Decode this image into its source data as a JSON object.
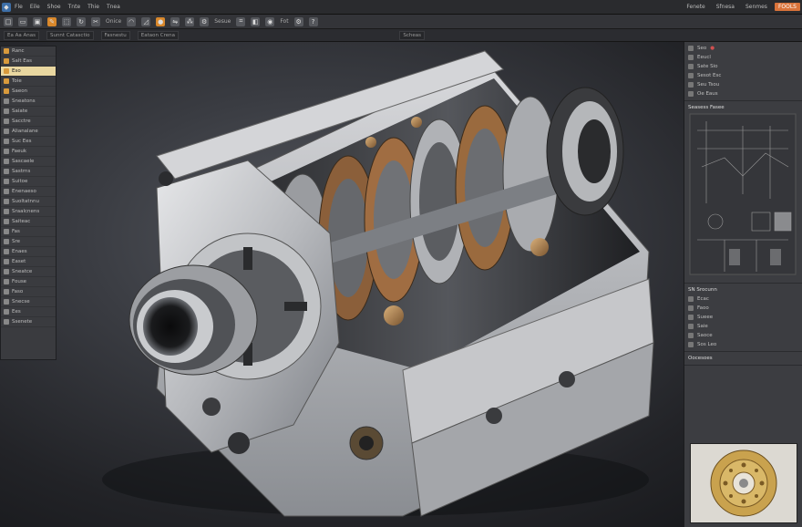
{
  "menubar": {
    "items": [
      "Fle",
      "Eile",
      "Shoe",
      "Tnte",
      "Thie",
      "Tnea"
    ],
    "right_items": [
      "Fenete",
      "Sfnesa",
      "Senmes"
    ],
    "action_label": "FOOLS"
  },
  "toolbar1": {
    "labels": [
      "Onice",
      "Sesue",
      "Fot"
    ]
  },
  "toolbar2": {
    "tabs": [
      "Ea Aa Anas",
      "Sunnt Catasctio",
      "Fasnestu",
      "Eataon Crena",
      "Scheas"
    ]
  },
  "left_panel": {
    "rows": [
      {
        "label": "Ranc",
        "icon": "folder-icon",
        "selected": false
      },
      {
        "label": "Salt Eas",
        "icon": "folder-icon",
        "selected": false
      },
      {
        "label": "Eso",
        "icon": "folder-icon",
        "selected": true
      },
      {
        "label": "Toie",
        "icon": "folder-icon",
        "selected": false
      },
      {
        "label": "Saeon",
        "icon": "folder-icon",
        "selected": false
      },
      {
        "label": "Sneatons",
        "icon": "part-icon",
        "selected": false
      },
      {
        "label": "Saiate",
        "icon": "part-icon",
        "selected": false
      },
      {
        "label": "Sacctre",
        "icon": "part-icon",
        "selected": false
      },
      {
        "label": "Alianalane",
        "icon": "part-icon",
        "selected": false
      },
      {
        "label": "Suc Ees",
        "icon": "part-icon",
        "selected": false
      },
      {
        "label": "Faeuk",
        "icon": "part-icon",
        "selected": false
      },
      {
        "label": "Sascaele",
        "icon": "part-icon",
        "selected": false
      },
      {
        "label": "Sastrns",
        "icon": "part-icon",
        "selected": false
      },
      {
        "label": "Suitoe",
        "icon": "part-icon",
        "selected": false
      },
      {
        "label": "Enenaeso",
        "icon": "part-icon",
        "selected": false
      },
      {
        "label": "Suoltatnnu",
        "icon": "part-icon",
        "selected": false
      },
      {
        "label": "Sraalcnens",
        "icon": "part-icon",
        "selected": false
      },
      {
        "label": "Saiteac",
        "icon": "part-icon",
        "selected": false
      },
      {
        "label": "Fas",
        "icon": "part-icon",
        "selected": false
      },
      {
        "label": "Sre",
        "icon": "part-icon",
        "selected": false
      },
      {
        "label": "Enaes",
        "icon": "part-icon",
        "selected": false
      },
      {
        "label": "Easet",
        "icon": "part-icon",
        "selected": false
      },
      {
        "label": "Sneatce",
        "icon": "part-icon",
        "selected": false
      },
      {
        "label": "Fouse",
        "icon": "part-icon",
        "selected": false
      },
      {
        "label": "Faso",
        "icon": "part-icon",
        "selected": false
      },
      {
        "label": "Snecse",
        "icon": "part-icon",
        "selected": false
      },
      {
        "label": "Ees",
        "icon": "part-icon",
        "selected": false
      },
      {
        "label": "Ssenete",
        "icon": "part-icon",
        "selected": false
      }
    ]
  },
  "right_panel": {
    "top_rows": [
      "Seo",
      "Eeucl",
      "Sate Sio",
      "Sesot Esc",
      "Seu Tsou",
      "Oe Eaus"
    ],
    "section1_title": "Seasess Fasee",
    "section2_title": "SN Srocunn",
    "section2_rows": [
      "Ecac",
      "Faoo",
      "Sueee",
      "Saie",
      "Saoce",
      "Sos Leo"
    ],
    "section3_title": "Oocesoes"
  },
  "colors": {
    "accent": "#d9733a",
    "selection": "#e9d7a0",
    "panel": "#3a3b3f"
  }
}
